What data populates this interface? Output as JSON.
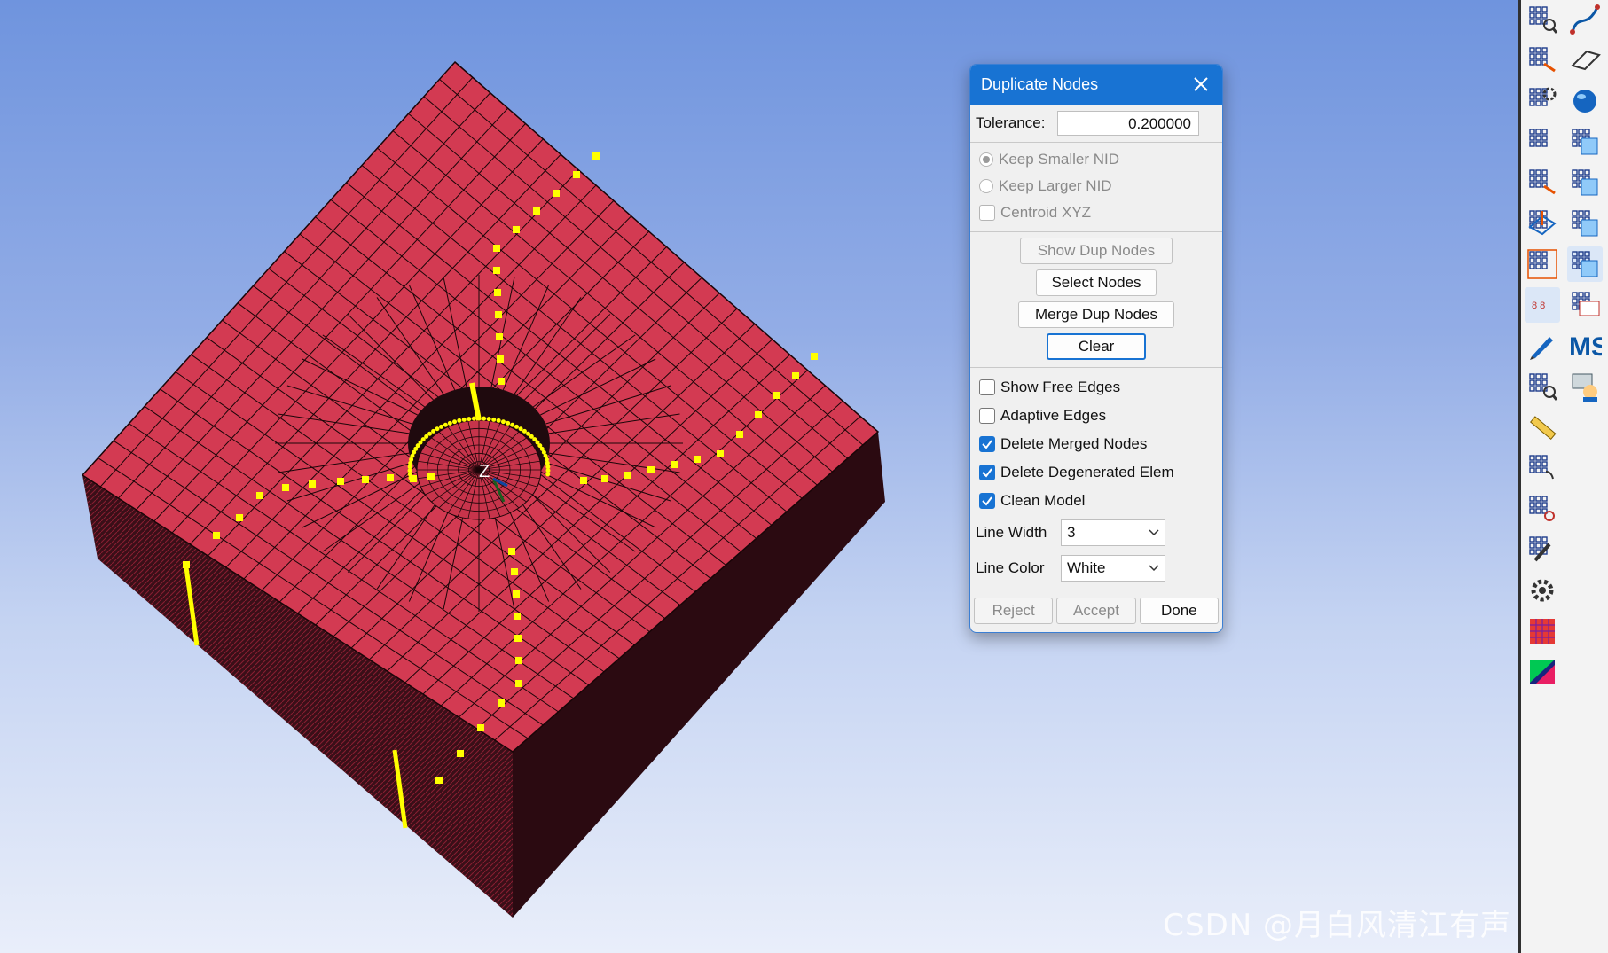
{
  "viewport": {
    "axis_label": "Z",
    "watermark": "CSDN @月白风清江有声"
  },
  "colors": {
    "mesh_fill": "#d33a52",
    "mesh_side": "#3a0f18",
    "highlight_nodes": "#ffff00",
    "background_top": "#6f94de",
    "background_bottom": "#e9eefa",
    "dialog_title_bar": "#1873d3"
  },
  "dialog": {
    "title": "Duplicate Nodes",
    "close_icon": "close-icon",
    "tolerance": {
      "label": "Tolerance:",
      "value": "0.200000"
    },
    "keep_options": [
      {
        "label": "Keep Smaller NID",
        "checked": true,
        "enabled": false
      },
      {
        "label": "Keep Larger NID",
        "checked": false,
        "enabled": false
      }
    ],
    "centroid": {
      "label": "Centroid XYZ",
      "checked": false,
      "enabled": false
    },
    "buttons": {
      "show_dup_nodes": "Show Dup Nodes",
      "select_nodes": "Select Nodes",
      "merge_dup_nodes": "Merge Dup Nodes",
      "clear": "Clear"
    },
    "options": [
      {
        "label": "Show Free Edges",
        "checked": false
      },
      {
        "label": "Adaptive Edges",
        "checked": false
      },
      {
        "label": "Delete Merged Nodes",
        "checked": true
      },
      {
        "label": "Delete Degenerated Elem",
        "checked": true
      },
      {
        "label": "Clean Model",
        "checked": true
      }
    ],
    "line_width": {
      "label": "Line Width",
      "value": "3"
    },
    "line_color": {
      "label": "Line Color",
      "value": "White"
    },
    "footer": {
      "reject": "Reject",
      "accept": "Accept",
      "done": "Done"
    }
  },
  "toolbar": {
    "left_column": [
      "node-search-icon",
      "node-move-icon",
      "node-gear-icon",
      "node-grid-icon",
      "node-grid-move-icon",
      "plane-node-icon",
      "node-frame-icon",
      "duplicate-nodes-icon",
      "pencil-icon",
      "node-search2-icon",
      "ruler-icon",
      "node-hand-icon",
      "node-link-icon",
      "node-wrench-icon",
      "gear-icon",
      "mesh-grid-icon",
      "mesh-color-icon"
    ],
    "right_column": [
      "curve-icon",
      "surface-icon",
      "solid-icon",
      "box-part-icon",
      "mesh-part-icon",
      "table-part-icon",
      "node-table-icon",
      "id-card-icon",
      "ms-icon",
      "user-help-icon"
    ],
    "ms_text": "MS",
    "dup_text": "8 8"
  }
}
